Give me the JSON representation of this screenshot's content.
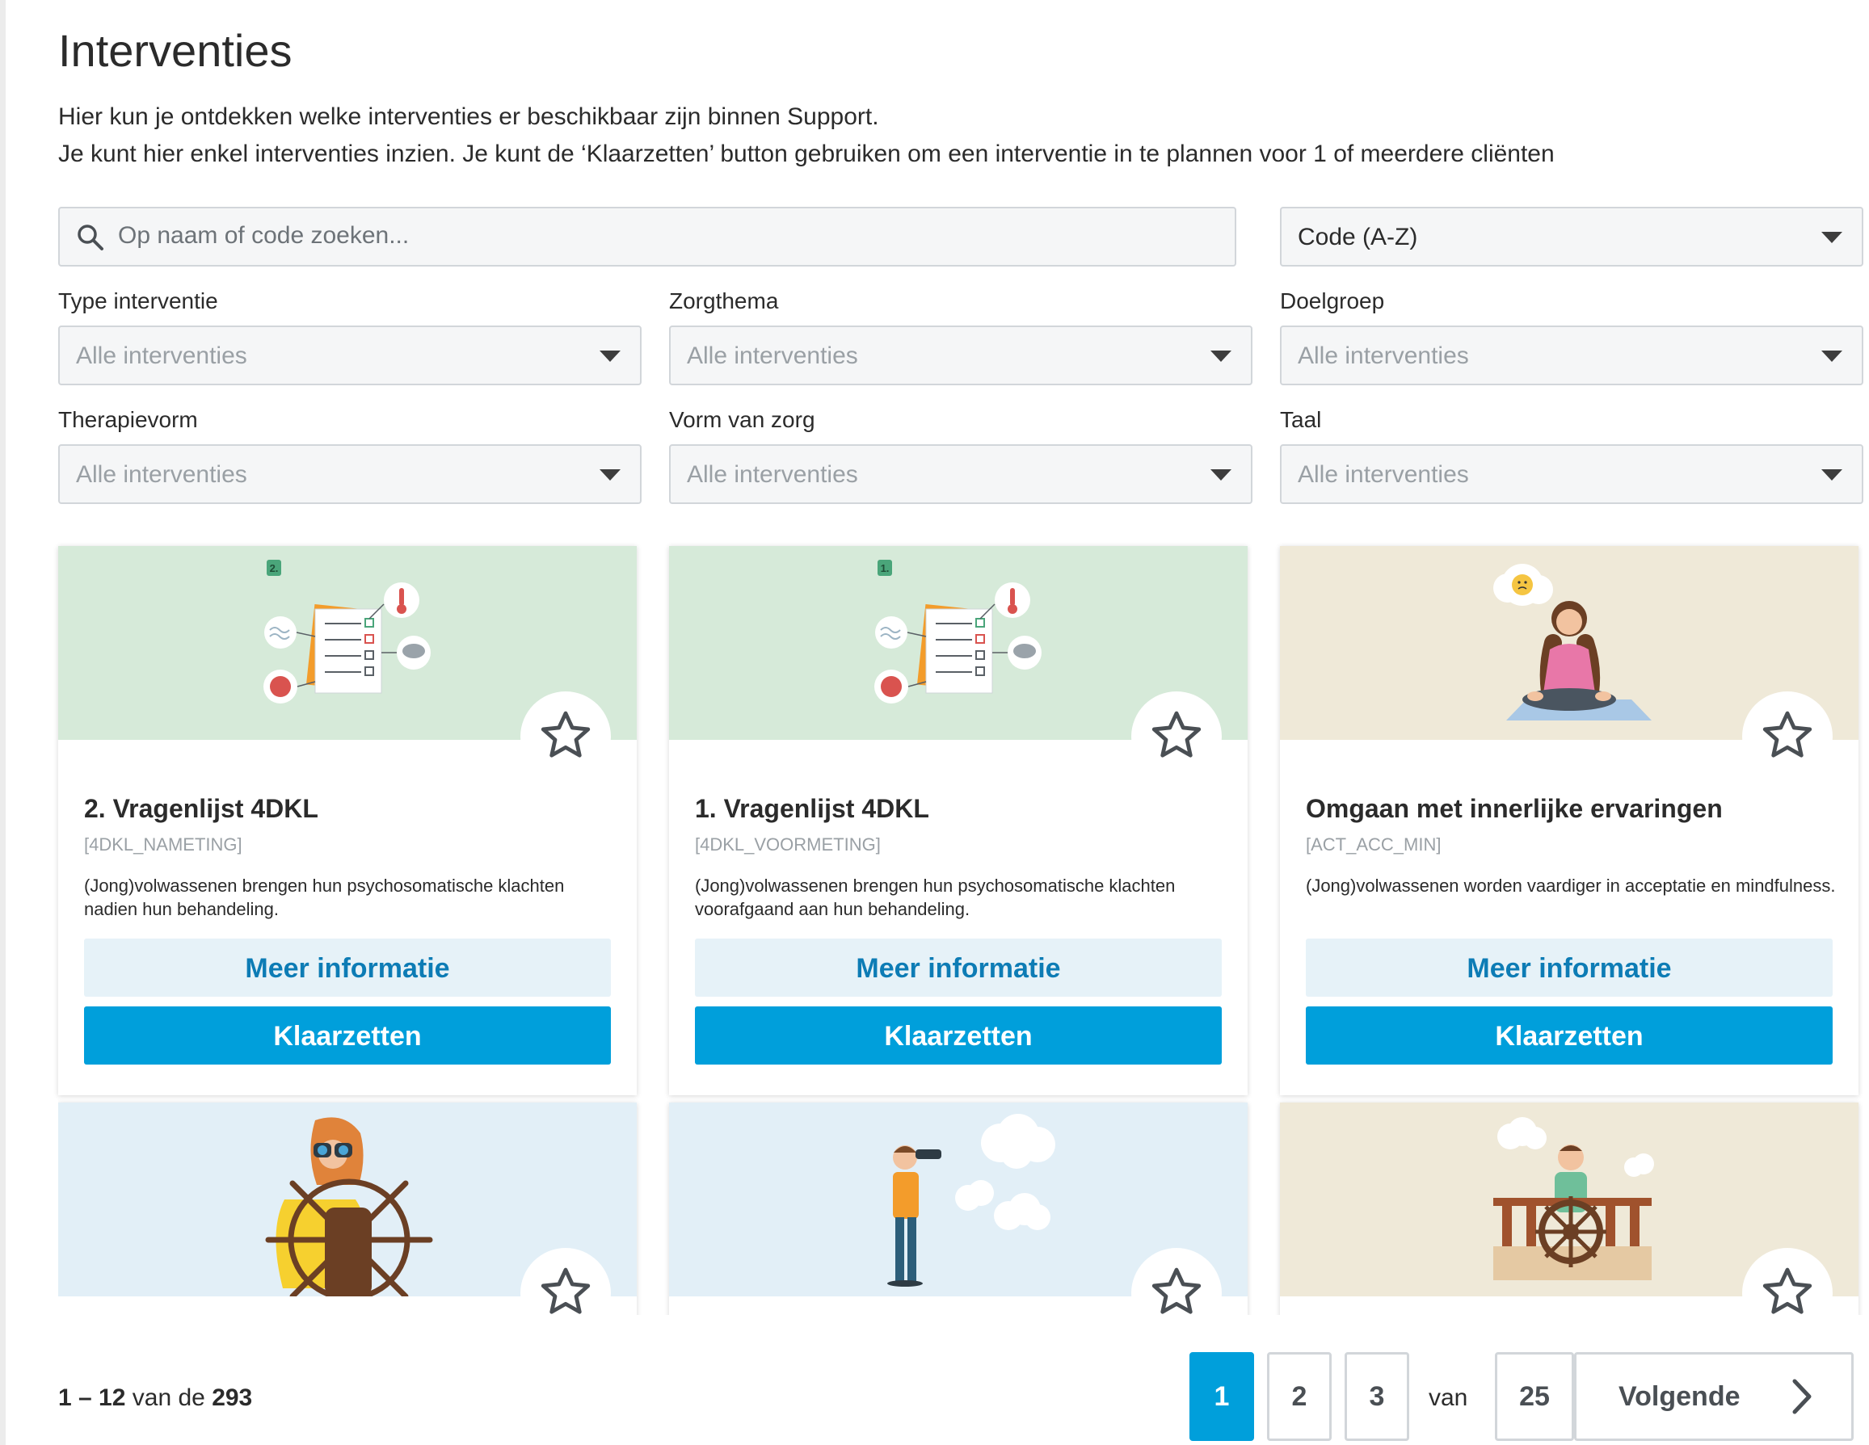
{
  "page": {
    "title": "Interventies",
    "intro_line1": "Hier kun je ontdekken welke interventies er beschikbaar zijn binnen Support.",
    "intro_line2": "Je kunt hier enkel interventies inzien. Je kunt de ‘Klaarzetten’ button gebruiken om een interventie in te plannen voor 1 of meerdere cliënten"
  },
  "search": {
    "placeholder": "Op naam of code zoeken..."
  },
  "sort": {
    "value": "Code (A-Z)"
  },
  "filters": [
    {
      "label": "Type interventie",
      "value": "Alle interventies"
    },
    {
      "label": "Zorgthema",
      "value": "Alle interventies"
    },
    {
      "label": "Doelgroep",
      "value": "Alle interventies"
    },
    {
      "label": "Therapievorm",
      "value": "Alle interventies"
    },
    {
      "label": "Vorm van zorg",
      "value": "Alle interventies"
    },
    {
      "label": "Taal",
      "value": "Alle interventies"
    }
  ],
  "cards": [
    {
      "title": "2. Vragenlijst 4DKL",
      "code": "[4DKL_NAMETING]",
      "description": "(Jong)volwassenen brengen hun psychosomatische klachten nadien hun behandeling.",
      "badge": "2.",
      "more_label": "Meer informatie",
      "action_label": "Klaarzetten",
      "hero_color": "#d6ead9",
      "illustration": "questionnaire-illustration"
    },
    {
      "title": "1. Vragenlijst 4DKL",
      "code": "[4DKL_VOORMETING]",
      "description": "(Jong)volwassenen brengen hun psychosomatische klachten voorafgaand aan hun behandeling.",
      "badge": "1.",
      "more_label": "Meer informatie",
      "action_label": "Klaarzetten",
      "hero_color": "#d6ead9",
      "illustration": "questionnaire-illustration"
    },
    {
      "title": "Omgaan met innerlijke ervaringen",
      "code": "[ACT_ACC_MIN]",
      "description": "(Jong)volwassenen worden vaardiger in acceptatie en mindfulness.",
      "more_label": "Meer informatie",
      "action_label": "Klaarzetten",
      "hero_color": "#efe9d8",
      "illustration": "meditation-illustration"
    },
    {
      "hero_color": "#e2eff7",
      "illustration": "binoculars-wheel-illustration"
    },
    {
      "hero_color": "#e2eff7",
      "illustration": "telescope-person-illustration"
    },
    {
      "hero_color": "#efe9d8",
      "illustration": "ship-helm-illustration"
    }
  ],
  "pagination": {
    "range_start": "1",
    "range_end": "12",
    "range_of": "van de",
    "total": "293",
    "pages": [
      "1",
      "2",
      "3"
    ],
    "current": "1",
    "of_label": "van",
    "last_page": "25",
    "next_label": "Volgende"
  },
  "colors": {
    "accent": "#009fdb",
    "accent_light": "#e6f2f8",
    "link": "#0d7cb5"
  }
}
